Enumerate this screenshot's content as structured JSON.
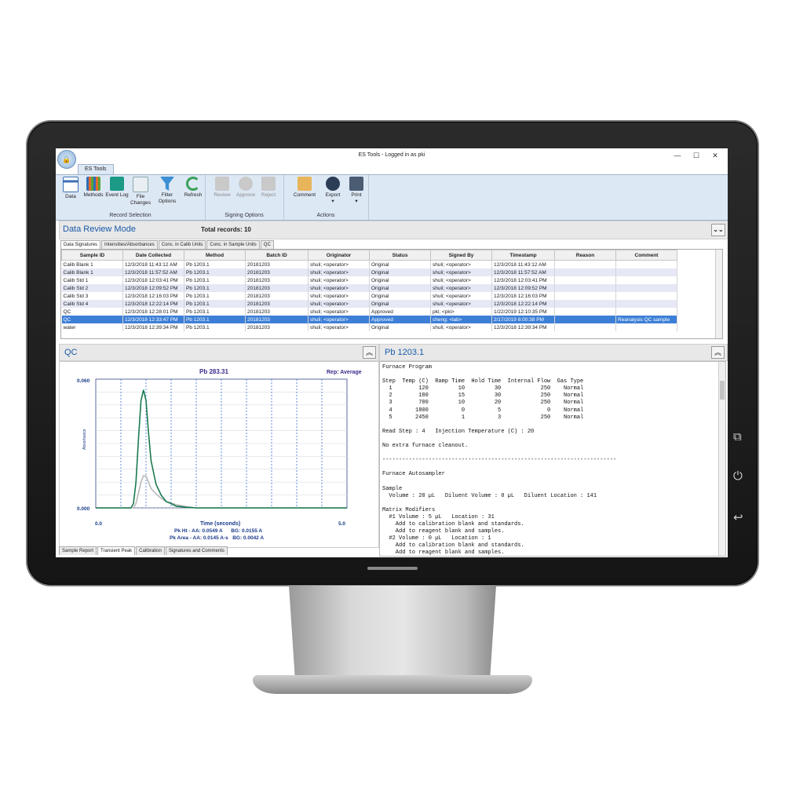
{
  "window": {
    "title": "ES Tools - Logged in as pki",
    "controls": [
      "—",
      "☐",
      "✕"
    ]
  },
  "ribbon": {
    "tab": "ES Tools",
    "groups": [
      {
        "label": "Record Selection",
        "buttons": [
          "Data",
          "Methods",
          "Event Log",
          "File Changes",
          "Filter Options",
          "Refresh"
        ]
      },
      {
        "label": "Signing Options",
        "buttons": [
          "Review",
          "Approve",
          "Reject"
        ]
      },
      {
        "label": "Actions",
        "buttons": [
          "Comment",
          "Export",
          "Print"
        ]
      }
    ]
  },
  "mode": {
    "title": "Data Review Mode",
    "total_records": "Total records: 10"
  },
  "data_tabs": [
    "Data Signatures",
    "Intensities/Absorbances",
    "Conc. in Calib Units",
    "Conc. in Sample Units",
    "QC"
  ],
  "table": {
    "columns": [
      "Sample ID",
      "Date Collected",
      "Method",
      "Batch ID",
      "Originator",
      "Status",
      "Signed By",
      "Timestamp",
      "Reason",
      "Comment"
    ],
    "rows": [
      [
        "Calib Blank 1",
        "12/3/2018 11:43:12 AM",
        "Pb 1203.1",
        "20181203",
        "shuli; <operator>",
        "Original",
        "shuli; <operator>",
        "12/3/2018 11:43:12 AM",
        "",
        ""
      ],
      [
        "Calib Blank 1",
        "12/3/2018 11:57:52 AM",
        "Pb 1203.1",
        "20181203",
        "shuli; <operator>",
        "Original",
        "shuli; <operator>",
        "12/3/2018 11:57:52 AM",
        "",
        ""
      ],
      [
        "Calib Std 1",
        "12/3/2018 12:03:41 PM",
        "Pb 1203.1",
        "20181203",
        "shuli; <operator>",
        "Original",
        "shuli; <operator>",
        "12/3/2018 12:03:41 PM",
        "",
        ""
      ],
      [
        "Calib Std 2",
        "12/3/2018 12:09:52 PM",
        "Pb 1203.1",
        "20181203",
        "shuli; <operator>",
        "Original",
        "shuli; <operator>",
        "12/3/2018 12:09:52 PM",
        "",
        ""
      ],
      [
        "Calib Std 3",
        "12/3/2018 12:16:03 PM",
        "Pb 1203.1",
        "20181203",
        "shuli; <operator>",
        "Original",
        "shuli; <operator>",
        "12/3/2018 12:16:03 PM",
        "",
        ""
      ],
      [
        "Calib Std 4",
        "12/3/2018 12:22:14 PM",
        "Pb 1203.1",
        "20181203",
        "shuli; <operator>",
        "Original",
        "shuli; <operator>",
        "12/3/2018 12:22:14 PM",
        "",
        ""
      ],
      [
        "QC",
        "12/3/2018 12:28:01 PM",
        "Pb 1203.1",
        "20181203",
        "shuli; <operator>",
        "Approved",
        "pki; <pki>",
        "1/22/2019 12:10:35 PM",
        "",
        ""
      ],
      [
        "QC",
        "12/3/2018 12:33:47 PM",
        "Pb 1203.1",
        "20181203",
        "shuli; <operator>",
        "Approved",
        "cheng; <lab>",
        "2/17/2019 8:00:38 PM",
        "",
        "Reanalysis QC sample"
      ],
      [
        "water",
        "12/3/2018 12:39:34 PM",
        "Pb 1203.1",
        "20181203",
        "shuli; <operator>",
        "Original",
        "shuli; <operator>",
        "12/3/2018 12:39:34 PM",
        "",
        ""
      ]
    ],
    "selected_row": 7
  },
  "left_panel": {
    "title": "QC",
    "bottom_tabs": [
      "Sample Report",
      "Transient Peak",
      "Calibration",
      "Signatures and Comments"
    ]
  },
  "right_panel": {
    "title": "Pb 1203.1"
  },
  "chart_data": {
    "type": "line",
    "title": "Pb 283.31",
    "subtitle": "Rep: Average",
    "xlabel": "Time (seconds)",
    "ylabel": "Absorbance",
    "xlim": [
      0.0,
      5.0
    ],
    "ylim": [
      0.0,
      0.06
    ],
    "x_ticks": [
      "0.0",
      "5.0"
    ],
    "y_ticks": [
      "0.060",
      "0.000"
    ],
    "series": [
      {
        "color": "#1a7a50",
        "x": [
          0.0,
          0.7,
          0.75,
          0.8,
          0.85,
          0.9,
          0.95,
          1.0,
          1.05,
          1.1,
          1.2,
          1.3,
          1.4,
          1.5,
          1.6,
          1.8,
          2.0,
          3.0,
          5.0
        ],
        "y": [
          0.0,
          0.0,
          0.002,
          0.012,
          0.032,
          0.05,
          0.055,
          0.05,
          0.035,
          0.022,
          0.011,
          0.006,
          0.003,
          0.002,
          0.0008,
          0.0003,
          0.0,
          0.0,
          0.0
        ]
      },
      {
        "color": "#b8b8b8",
        "x": [
          0.0,
          0.75,
          0.8,
          0.85,
          0.9,
          0.95,
          1.0,
          1.05,
          1.1,
          1.2,
          1.3,
          1.4,
          1.6,
          1.8,
          2.0,
          5.0
        ],
        "y": [
          0.0,
          0.0,
          0.002,
          0.007,
          0.012,
          0.015,
          0.0148,
          0.012,
          0.009,
          0.0065,
          0.0045,
          0.003,
          0.0015,
          0.0006,
          0.0,
          0.0
        ]
      }
    ],
    "vertical_markers": [
      0.5,
      1.0,
      1.5,
      2.0,
      2.5,
      3.0,
      3.5,
      4.0,
      4.5
    ],
    "grid": true,
    "annotations": [
      "Pk Ht - AA: 0.0549 A      BG: 0.0155 A",
      "Pk Area - AA: 0.0145 A-s   BG: 0.0042 A"
    ]
  },
  "report_text": "Furnace Program\n\nStep  Temp (C)  Ramp Time  Hold Time  Internal Flow  Gas Type\n  1        120         10         30            250    Normal\n  2        180         15         30            250    Normal\n  3        700         10         20            250    Normal\n  4       1800          0          5              0    Normal\n  5       2450          1          3            250    Normal\n\nRead Step : 4   Injection Temperature (C) : 20\n\nNo extra furnace cleanout.\n\n-----------------------------------------------------------------------\n\nFurnace Autosampler\n\nSample\n  Volume : 20 µL   Diluent Volume : 0 µL   Diluent Location : 141\n\nMatrix Modifiers\n  #1 Volume : 5 µL   Location : 31\n    Add to calibration blank and standards.\n    Add to reagent blank and samples.\n  #2 Volume : 0 µL   Location : 1\n    Add to calibration blank and standards.\n    Add to reagent blank and samples."
}
